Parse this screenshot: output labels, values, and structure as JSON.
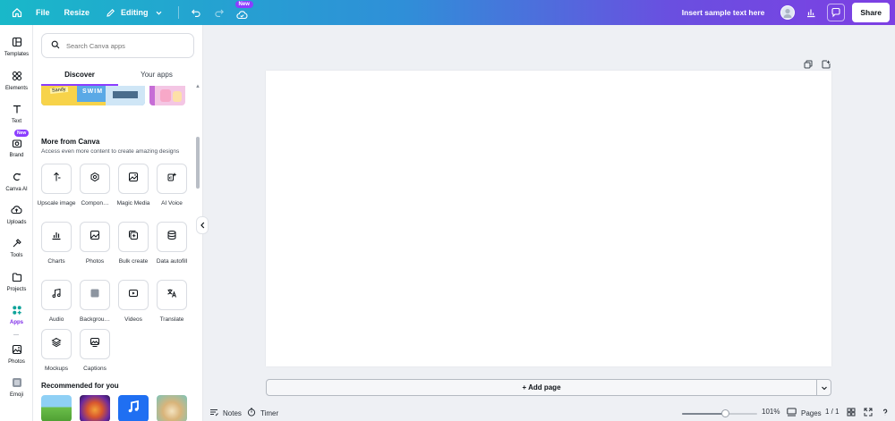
{
  "topbar": {
    "file": "File",
    "resize": "Resize",
    "editing": "Editing",
    "new_badge": "New",
    "sample_text": "Insert sample text here",
    "share": "Share"
  },
  "rail": {
    "items": [
      {
        "label": "Templates",
        "icon": "templates-icon"
      },
      {
        "label": "Elements",
        "icon": "elements-icon"
      },
      {
        "label": "Text",
        "icon": "text-icon"
      },
      {
        "label": "Brand",
        "icon": "brand-icon"
      },
      {
        "label": "Canva AI",
        "icon": "canva-ai-icon"
      },
      {
        "label": "Uploads",
        "icon": "uploads-icon"
      },
      {
        "label": "Tools",
        "icon": "tools-icon"
      },
      {
        "label": "Projects",
        "icon": "projects-icon"
      },
      {
        "label": "Apps",
        "icon": "apps-icon"
      },
      {
        "label": "Photos",
        "icon": "photos-icon"
      },
      {
        "label": "Emoji",
        "icon": "emoji-icon"
      }
    ],
    "brand_badge": "New",
    "active": "Apps"
  },
  "panel": {
    "search_placeholder": "Search Canva apps",
    "tabs": [
      "Discover",
      "Your apps"
    ],
    "active_tab": "Discover",
    "banner_text": [
      "Sandy",
      "SWIM"
    ],
    "more_title": "More from Canva",
    "more_sub": "Access even more content to create amazing designs",
    "apps": [
      {
        "label": "Upscale image",
        "icon": "upscale-icon"
      },
      {
        "label": "Compon…",
        "icon": "components-icon"
      },
      {
        "label": "Magic Media",
        "icon": "magic-media-icon"
      },
      {
        "label": "AI Voice",
        "icon": "ai-voice-icon"
      },
      {
        "label": "Charts",
        "icon": "charts-icon"
      },
      {
        "label": "Photos",
        "icon": "photos-icon"
      },
      {
        "label": "Bulk create",
        "icon": "bulk-create-icon"
      },
      {
        "label": "Data autofill",
        "icon": "data-autofill-icon"
      },
      {
        "label": "Audio",
        "icon": "audio-icon"
      },
      {
        "label": "Backgrou…",
        "icon": "background-icon"
      },
      {
        "label": "Videos",
        "icon": "videos-icon"
      },
      {
        "label": "Translate",
        "icon": "translate-icon"
      },
      {
        "label": "Mockups",
        "icon": "mockups-icon"
      },
      {
        "label": "Captions",
        "icon": "captions-icon"
      }
    ],
    "recommended_title": "Recommended for you"
  },
  "canvas": {
    "add_page": "+ Add page"
  },
  "footer": {
    "notes": "Notes",
    "timer": "Timer",
    "zoom": "101%",
    "zoom_fraction": 0.58,
    "pages": "Pages",
    "page_count": "1 / 1"
  },
  "colors": {
    "accent": "#8b3dff",
    "gradient_start": "#19b8c9",
    "gradient_end": "#7d3fe3"
  }
}
